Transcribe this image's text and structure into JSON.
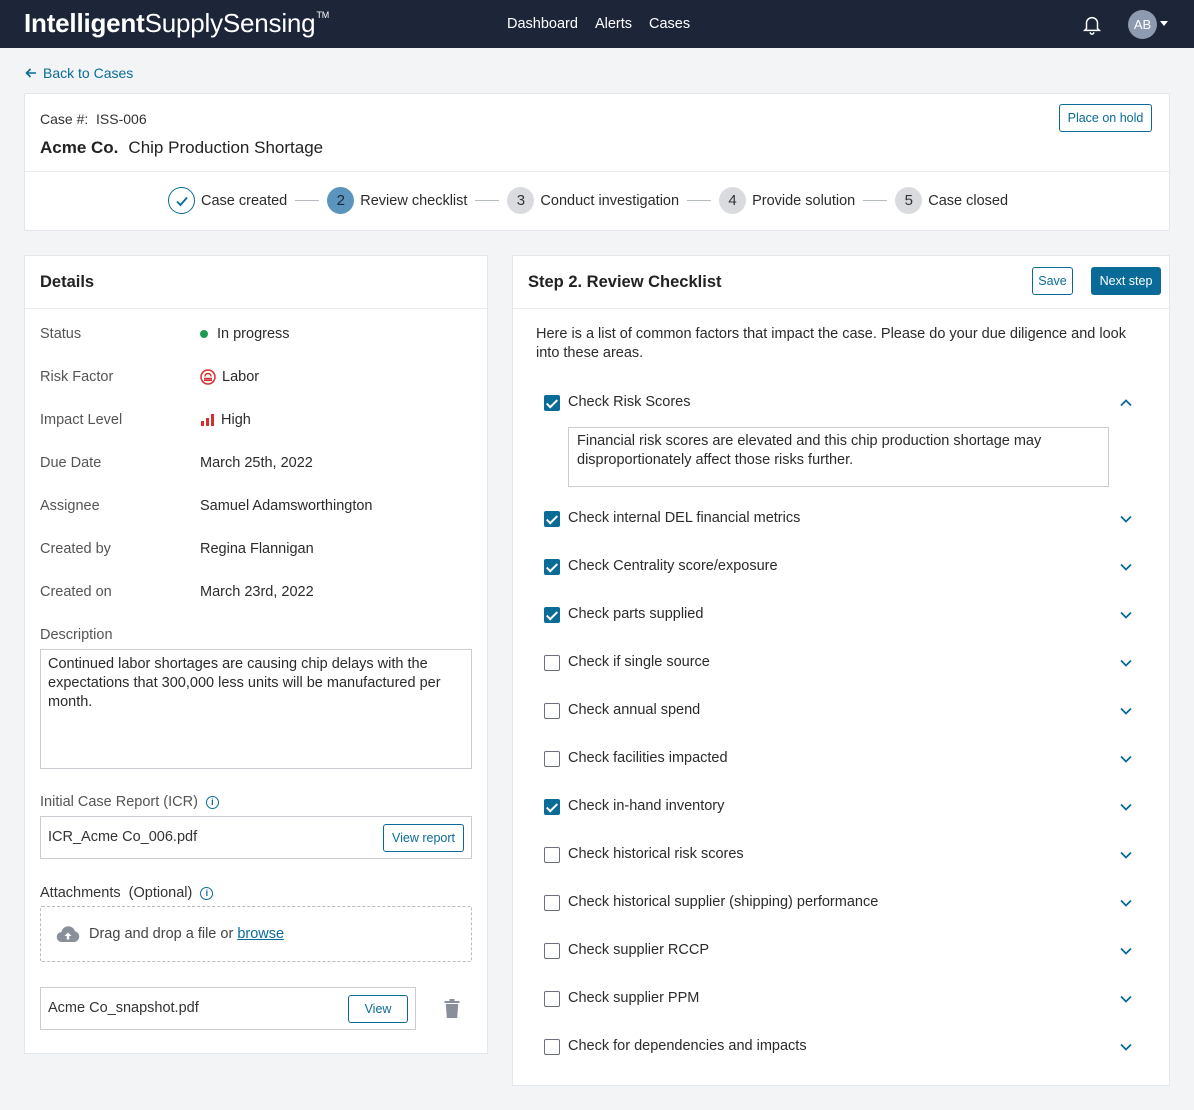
{
  "app": {
    "logo_bold": "Intelligent",
    "logo_rest": "SupplySensing",
    "logo_tm": "TM",
    "nav": [
      "Dashboard",
      "Alerts",
      "Cases"
    ],
    "avatar_initials": "AB"
  },
  "back_link": "Back to Cases",
  "case": {
    "number_label": "Case #:",
    "number": "ISS-006",
    "company": "Acme Co.",
    "title": "Chip Production Shortage",
    "hold_button": "Place on hold"
  },
  "steps": [
    {
      "num": "✓",
      "label": "Case created",
      "state": "done"
    },
    {
      "num": "2",
      "label": "Review checklist",
      "state": "active"
    },
    {
      "num": "3",
      "label": "Conduct investigation",
      "state": "todo"
    },
    {
      "num": "4",
      "label": "Provide solution",
      "state": "todo"
    },
    {
      "num": "5",
      "label": "Case closed",
      "state": "todo"
    }
  ],
  "details": {
    "heading": "Details",
    "rows": [
      {
        "label": "Status",
        "value": "In progress",
        "icon": "status-dot"
      },
      {
        "label": "Risk Factor",
        "value": "Labor",
        "icon": "labor-icon"
      },
      {
        "label": "Impact Level",
        "value": "High",
        "icon": "signal-high-icon"
      },
      {
        "label": "Due Date",
        "value": "March 25th, 2022"
      },
      {
        "label": "Assignee",
        "value": "Samuel Adamsworthington"
      },
      {
        "label": "Created by",
        "value": "Regina Flannigan"
      },
      {
        "label": "Created on",
        "value": "March 23rd, 2022"
      }
    ],
    "description_label": "Description",
    "description": "Continued labor shortages are causing chip delays with the expectations that 300,000 less units will be manufactured per month.",
    "icr_label": "Initial Case Report (ICR)",
    "icr_file": "ICR_Acme Co_006.pdf",
    "icr_button": "View report",
    "attachments_label": "Attachments  (Optional)",
    "drop_text": "Drag and drop a file or",
    "browse_text": "browse",
    "attachment_file": "Acme Co_snapshot.pdf",
    "attachment_button": "View"
  },
  "checklist": {
    "heading": "Step 2. Review Checklist",
    "save_button": "Save",
    "next_button": "Next step",
    "intro": "Here is a list of common factors that impact the case. Please do your due diligence and look into these areas.",
    "expanded_note": "Financial risk scores are elevated and this chip production shortage may disproportionately affect those risks further.",
    "items": [
      {
        "label": "Check Risk Scores",
        "checked": true,
        "expanded": true
      },
      {
        "label": "Check internal DEL financial metrics",
        "checked": true,
        "expanded": false
      },
      {
        "label": "Check Centrality score/exposure",
        "checked": true,
        "expanded": false
      },
      {
        "label": "Check parts supplied",
        "checked": true,
        "expanded": false
      },
      {
        "label": "Check if single source",
        "checked": false,
        "expanded": false
      },
      {
        "label": "Check annual spend",
        "checked": false,
        "expanded": false
      },
      {
        "label": "Check facilities impacted",
        "checked": false,
        "expanded": false
      },
      {
        "label": "Check in-hand inventory",
        "checked": true,
        "expanded": false
      },
      {
        "label": "Check historical risk scores",
        "checked": false,
        "expanded": false
      },
      {
        "label": "Check historical supplier (shipping) performance",
        "checked": false,
        "expanded": false
      },
      {
        "label": "Check supplier RCCP",
        "checked": false,
        "expanded": false
      },
      {
        "label": "Check supplier PPM",
        "checked": false,
        "expanded": false
      },
      {
        "label": "Check for dependencies and impacts",
        "checked": false,
        "expanded": false
      }
    ]
  },
  "colors": {
    "nav_bg": "#1d2639",
    "accent": "#0a6b98",
    "status_green": "#1e9b4f",
    "risk_red": "#d32f2f"
  }
}
